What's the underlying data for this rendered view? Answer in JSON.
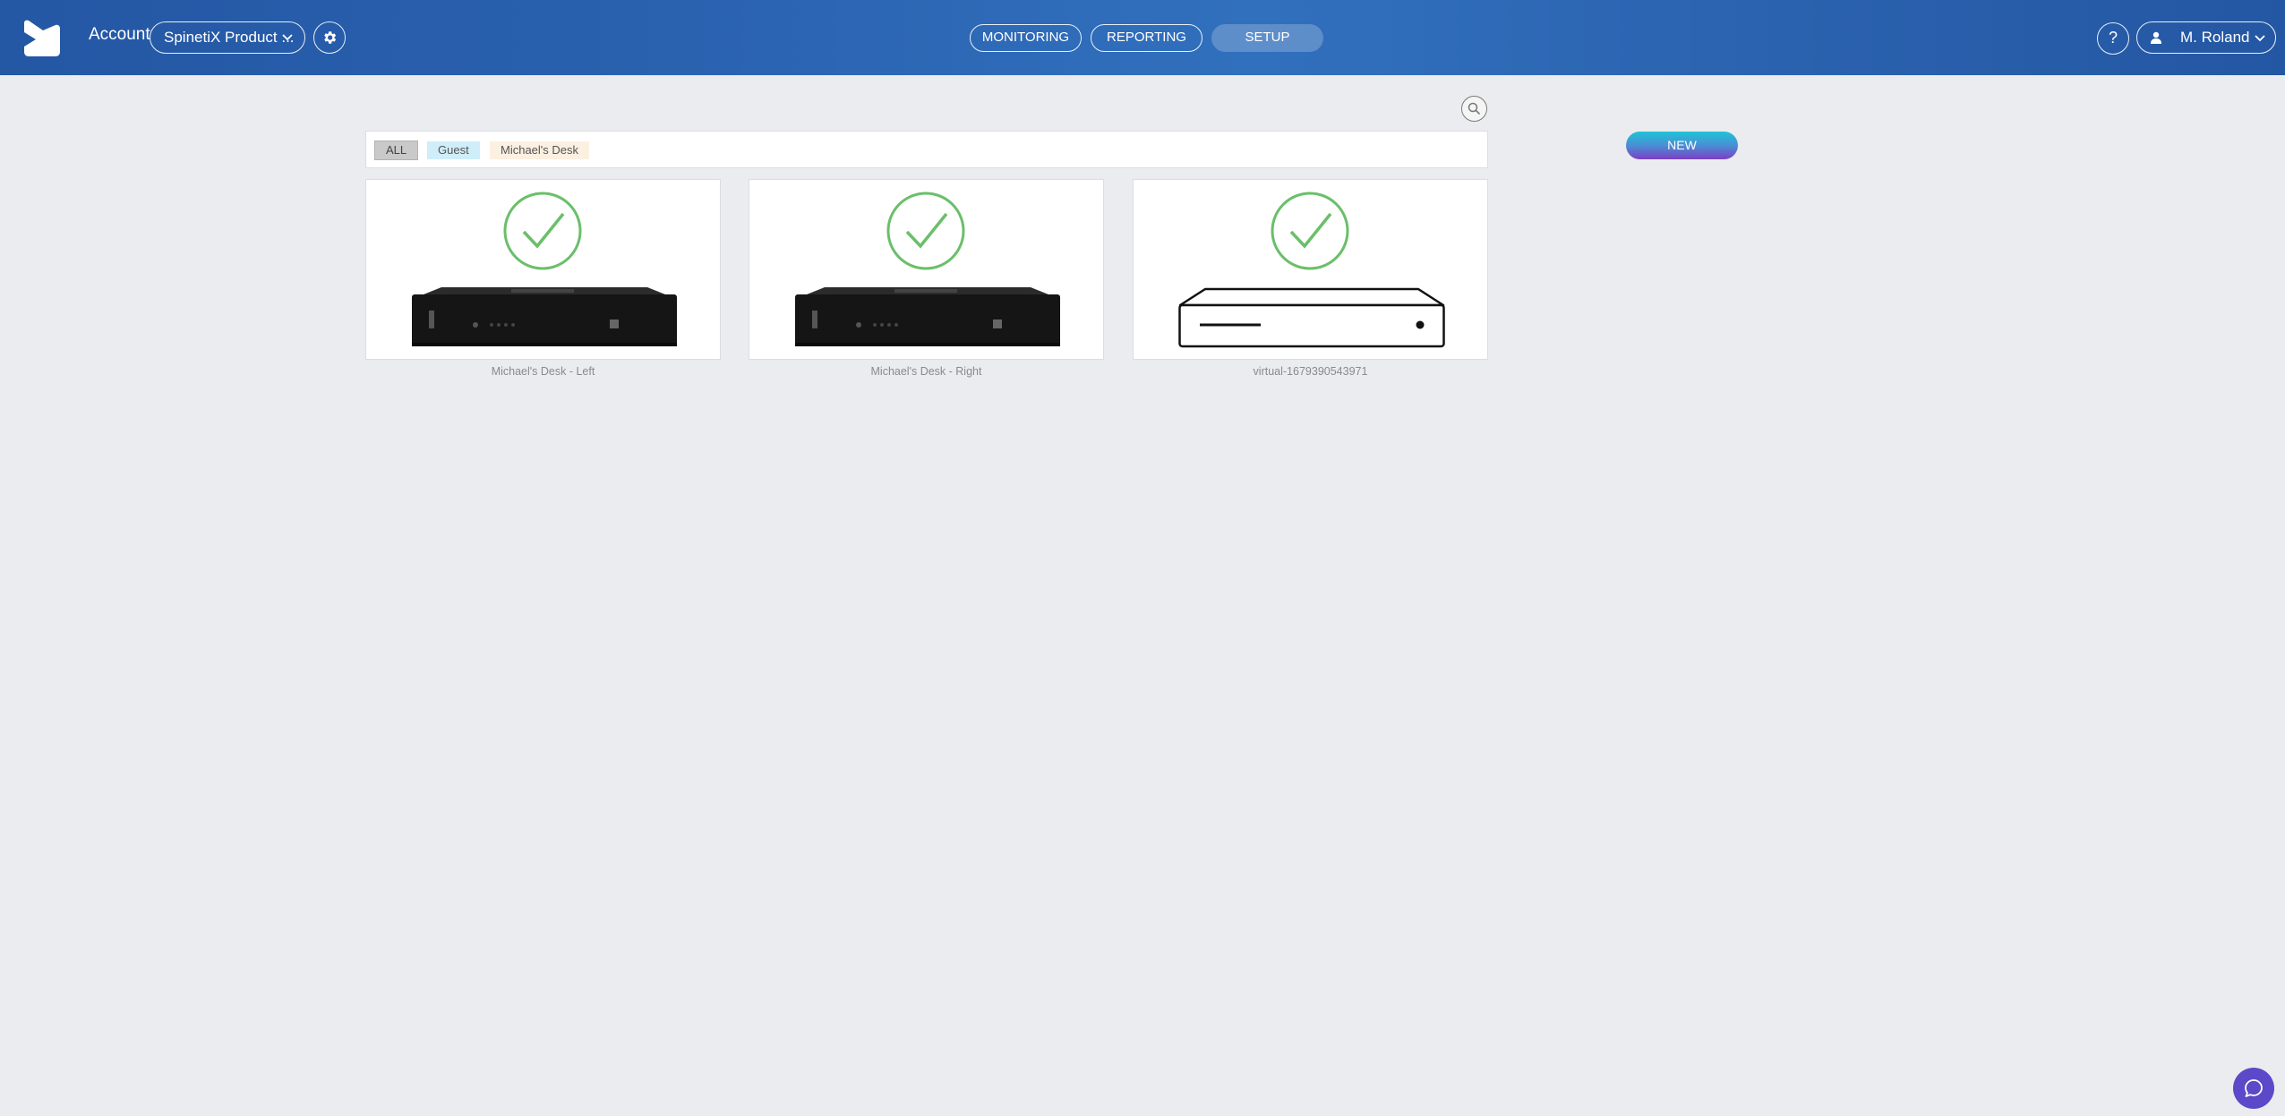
{
  "header": {
    "account_label": "Account",
    "account_select_value": "SpinetiX Product ...",
    "nav": [
      {
        "label": "MONITORING",
        "active": false
      },
      {
        "label": "REPORTING",
        "active": false
      },
      {
        "label": "SETUP",
        "active": true
      }
    ],
    "help_label": "?",
    "user_name": "M. Roland"
  },
  "toolbar": {
    "new_label": "NEW"
  },
  "filters": {
    "tags": [
      {
        "label": "ALL",
        "color": "#c9c9c9"
      },
      {
        "label": "Guest",
        "color": "#cfeefa"
      },
      {
        "label": "Michael's Desk",
        "color": "#fcf0e1"
      }
    ]
  },
  "devices": [
    {
      "name": "Michael's Desk - Left",
      "status": "ok",
      "status_color": "#6abf69",
      "icon": "media-player-photo"
    },
    {
      "name": "Michael's Desk - Right",
      "status": "ok",
      "status_color": "#6abf69",
      "icon": "media-player-photo"
    },
    {
      "name": "virtual-1679390543971",
      "status": "ok",
      "status_color": "#6abf69",
      "icon": "virtual-player-outline"
    }
  ],
  "colors": {
    "header": "#2a62b0",
    "background": "#ebecf0",
    "chat": "#5a49c8"
  }
}
